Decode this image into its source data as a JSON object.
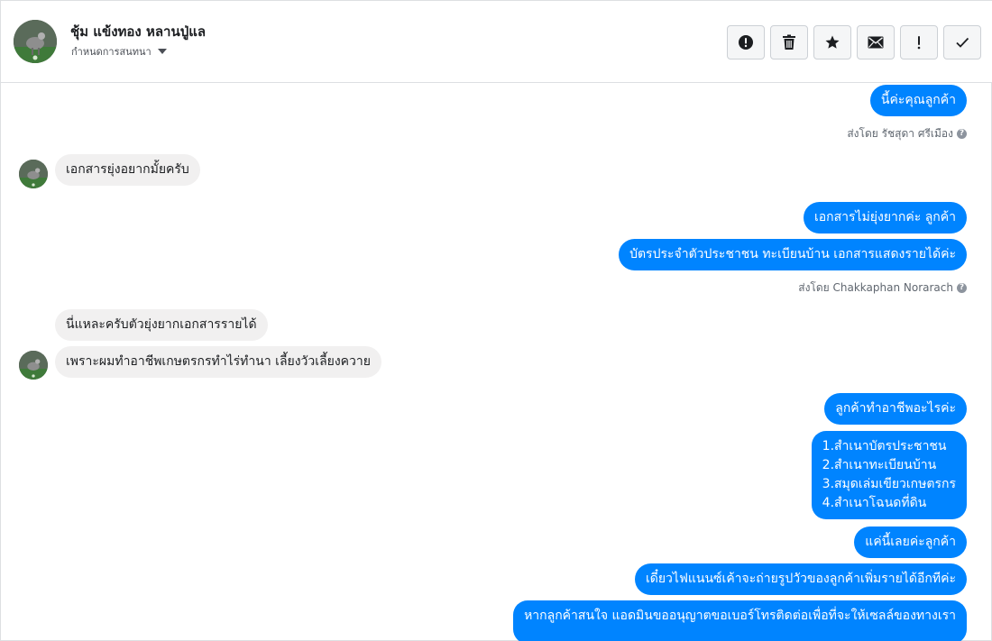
{
  "header": {
    "contact_name": "ชุ้ม แข้งทอง หลานปู่แล",
    "assign_label": "กำหนดการสนทนา",
    "toolbar": [
      {
        "icon": "alert-circle-icon",
        "label": "Mark as spam"
      },
      {
        "icon": "trash-icon",
        "label": "Delete"
      },
      {
        "icon": "star-icon",
        "label": "Star"
      },
      {
        "icon": "envelope-icon",
        "label": "Mark as unread"
      },
      {
        "icon": "exclamation-icon",
        "label": "Follow up"
      },
      {
        "icon": "check-icon",
        "label": "Mark as done"
      }
    ]
  },
  "messages": {
    "m1": "นี้ค่ะคุณลูกค้า",
    "sent1": "ส่งโดย รัชสุดา ศรีเมือง",
    "m2": "เอกสารยุ่งอยากมั้ยครับ",
    "m3": "เอกสารไม่ยุ่งยากค่ะ ลูกค้า",
    "m4": "บัตรประจำตัวประชาชน ทะเบียนบ้าน เอกสารแสดงรายได้ค่ะ",
    "sent2": "ส่งโดย Chakkaphan Norarach",
    "m5": "นี่แหละครับตัวยุ่งยากเอกสารรายได้",
    "m6": "เพราะผมทำอาชีพเกษตรกรทำไร่ทำนา เลี้ยงวัวเลี้ยงควาย",
    "m7": "ลูกค้าทำอาชีพอะไรค่ะ",
    "m8_lines": [
      "1.สำเนาบัตรประชาชน",
      "2.สำเนาทะเบียนบ้าน",
      "3.สมุดเล่มเขียวเกษตรกร",
      "4.สำเนาโฉนดที่ดิน"
    ],
    "m9": "แค่นี้เลยค่ะลูกค้า",
    "m10": "เดี๋ยวไฟแนนซ์เค้าจะถ่ายรูปวัวของลูกค้าเพิ่มรายได้อีกทีค่ะ",
    "m11": "หากลูกค้าสนใจ แอดมินขออนุญาตขอเบอร์โทรติดต่อเพื่อที่จะให้เซลล์ของทางเรา"
  },
  "colors": {
    "outgoing_bubble": "#0084ff",
    "incoming_bubble": "#f1f0f0",
    "divider": "#dddfe2"
  }
}
